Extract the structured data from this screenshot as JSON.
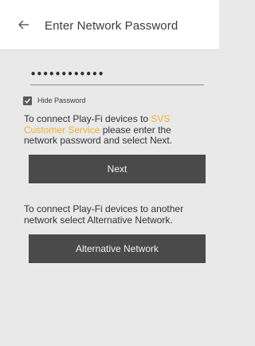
{
  "header": {
    "back_icon": "back-arrow-icon",
    "title": "Enter Network Password"
  },
  "password": {
    "value": "••••••••••••"
  },
  "hide_password": {
    "checked": true,
    "label": "Hide Password"
  },
  "info_primary": {
    "text_before": "To connect Play-Fi devices to ",
    "network_name": "SVS Customer Service",
    "text_after": " please enter the network password and select Next."
  },
  "next_button": {
    "label": "Next"
  },
  "info_secondary": {
    "text": "To connect Play-Fi devices to another network select Alternative Network."
  },
  "alternative_button": {
    "label": "Alternative Network"
  },
  "colors": {
    "accent": "#f2b233",
    "button_bg": "#4a4a4a",
    "background": "#e9e9e9",
    "header_bg": "#ffffff"
  }
}
